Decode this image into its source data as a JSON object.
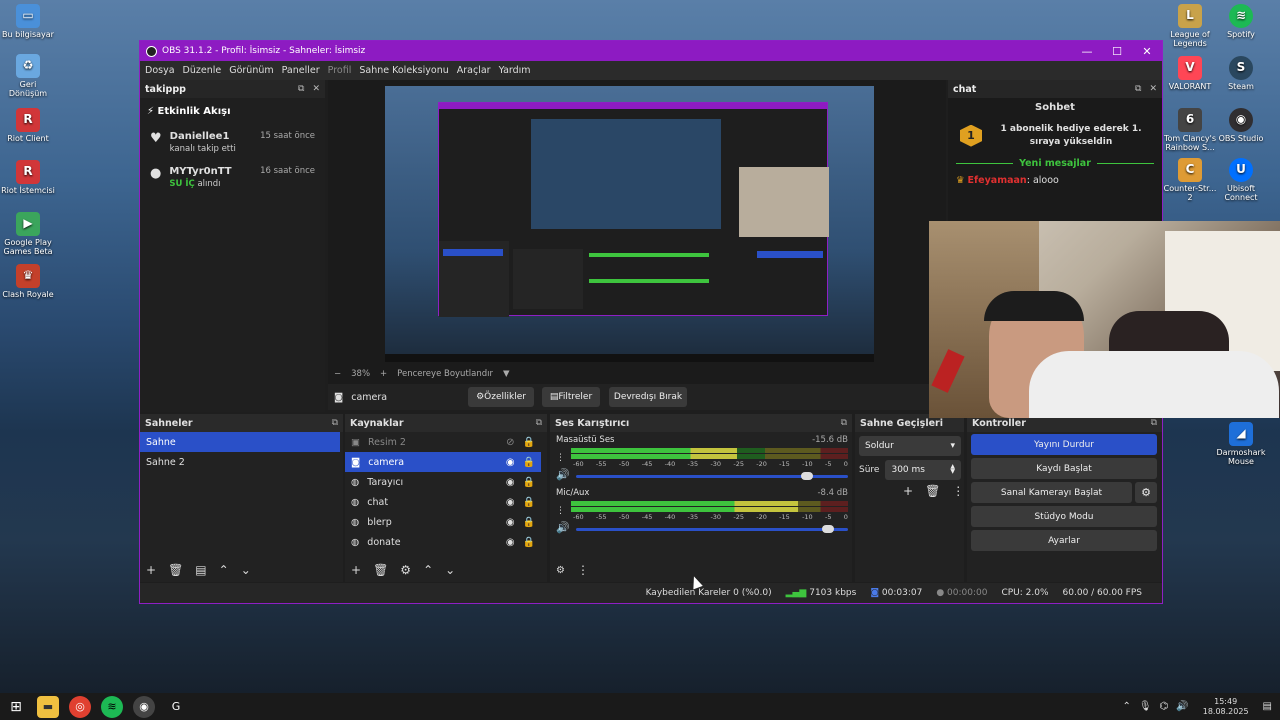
{
  "desktop_left": [
    {
      "label": "Bu bilgisayar",
      "icon": "pc-icon",
      "color": "#4a90d9"
    },
    {
      "label": "Geri Dönüşüm",
      "icon": "recycle-bin-icon",
      "color": "#6aa8e0"
    },
    {
      "label": "Riot Client",
      "icon": "riot-icon",
      "color": "#d13639"
    },
    {
      "label": "Riot İstemcisi",
      "icon": "riot-icon",
      "color": "#d13639"
    },
    {
      "label": "Google Play Games Beta",
      "icon": "google-play-icon",
      "color": "#3ba55c"
    },
    {
      "label": "Clash Royale",
      "icon": "clash-royale-icon",
      "color": "#c4402a"
    }
  ],
  "desktop_right": [
    {
      "label": "League of Legends",
      "icon": "league-icon",
      "color": "#c8a24a"
    },
    {
      "label": "Spotify",
      "icon": "spotify-icon",
      "color": "#1db954"
    },
    {
      "label": "VALORANT",
      "icon": "valorant-icon",
      "color": "#ff4655"
    },
    {
      "label": "Steam",
      "icon": "steam-icon",
      "color": "#2a475e"
    },
    {
      "label": "Tom Clancy's Rainbow S...",
      "icon": "rainbow-six-icon",
      "color": "#444"
    },
    {
      "label": "OBS Studio",
      "icon": "obs-icon",
      "color": "#302e31"
    },
    {
      "label": "Counter-Str... 2",
      "icon": "cs2-icon",
      "color": "#de9b35"
    },
    {
      "label": "Ubisoft Connect",
      "icon": "ubisoft-icon",
      "color": "#0070ff"
    },
    {
      "label": "Darmoshark Mouse",
      "icon": "mouse-icon",
      "color": "#1e6fd9"
    }
  ],
  "window": {
    "title": "OBS 31.1.2 - Profil: İsimsiz - Sahneler: İsimsiz",
    "menu": [
      "Dosya",
      "Düzenle",
      "Görünüm",
      "Paneller",
      "Profil",
      "Sahne Koleksiyonu",
      "Araçlar",
      "Yardım"
    ]
  },
  "takip_dock": {
    "title": "takippp",
    "header": "Etkinlik Akışı",
    "events": [
      {
        "name": "Daniellee1",
        "time": "15 saat önce",
        "detail": "kanalı takip etti",
        "highlight": ""
      },
      {
        "name": "MYTyr0nTT",
        "time": "16 saat önce",
        "detail": "alındı",
        "highlight": "SU İÇ"
      }
    ]
  },
  "chat_dock": {
    "title": "chat",
    "header": "Sohbet",
    "gift_text": "1 abonelik hediye ederek 1. sıraya yükseldin",
    "gift_rank": "1",
    "new_messages": "Yeni mesajlar",
    "msg_user": "Efeyamaan",
    "msg_text": "alooo"
  },
  "preview": {
    "zoom": "38%",
    "fit_label": "Pencereye Boyutlandır"
  },
  "source_bar": {
    "selected": "camera",
    "properties": "Özellikler",
    "filters": "Filtreler",
    "deactivate": "Devredışı Bırak"
  },
  "scenes": {
    "title": "Sahneler",
    "items": [
      "Sahne",
      "Sahne 2"
    ]
  },
  "sources": {
    "title": "Kaynaklar",
    "items": [
      {
        "name": "Resim 2",
        "icon": "image-icon",
        "hidden": true
      },
      {
        "name": "camera",
        "icon": "camera-icon",
        "hidden": false
      },
      {
        "name": "Tarayıcı",
        "icon": "browser-icon",
        "hidden": false
      },
      {
        "name": "chat",
        "icon": "browser-icon",
        "hidden": false
      },
      {
        "name": "blerp",
        "icon": "browser-icon",
        "hidden": false
      },
      {
        "name": "donate",
        "icon": "browser-icon",
        "hidden": false
      }
    ]
  },
  "mixer": {
    "title": "Ses Karıştırıcı",
    "ticks": [
      "-60",
      "-55",
      "-50",
      "-45",
      "-40",
      "-35",
      "-30",
      "-25",
      "-20",
      "-15",
      "-10",
      "-5",
      "0"
    ],
    "channels": [
      {
        "name": "Masaüstü Ses",
        "db": "-15.6 dB",
        "level": 0.6,
        "volume": 0.87
      },
      {
        "name": "Mic/Aux",
        "db": "-8.4 dB",
        "level": 0.82,
        "volume": 0.95
      }
    ]
  },
  "transitions": {
    "title": "Sahne Geçişleri",
    "type": "Soldur",
    "duration_label": "Süre",
    "duration": "300 ms"
  },
  "controls": {
    "title": "Kontroller",
    "stop_stream": "Yayını Durdur",
    "start_record": "Kaydı Başlat",
    "virtual_cam": "Sanal Kamerayı Başlat",
    "studio_mode": "Stüdyo Modu",
    "settings": "Ayarlar"
  },
  "status": {
    "dropped": "Kaybedilen Kareler 0 (%0.0)",
    "bitrate": "7103 kbps",
    "stream_time": "00:03:07",
    "record_time": "00:00:00",
    "cpu": "CPU: 2.0%",
    "fps": "60.00 / 60.00 FPS"
  },
  "taskbar": {
    "time": "15:49",
    "date": "18.08.2025"
  },
  "colors": {
    "accent": "#2a50c8",
    "titlebar": "#8d1bc2",
    "green": "#3ec43e"
  }
}
